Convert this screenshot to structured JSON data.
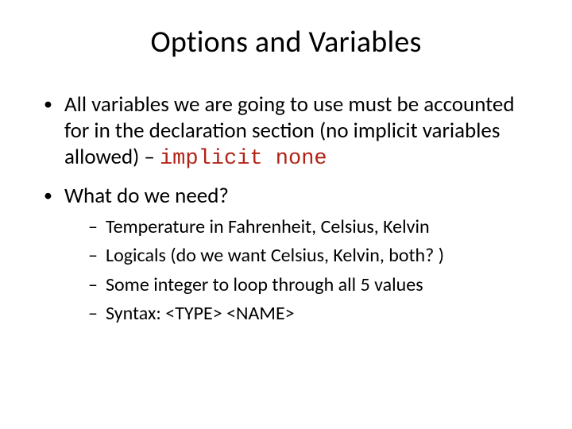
{
  "title": "Options and Variables",
  "bullets": {
    "b1_prefix": "All variables we are going to use must be accounted for in the declaration section (no implicit variables allowed) – ",
    "b1_code": "implicit none",
    "b2": "What do we need?"
  },
  "subs": {
    "s1": "Temperature in Fahrenheit, Celsius, Kelvin",
    "s2": "Logicals (do we want Celsius, Kelvin, both? )",
    "s3": "Some integer to loop through all 5 values",
    "s4": "Syntax: <TYPE> <NAME>"
  }
}
